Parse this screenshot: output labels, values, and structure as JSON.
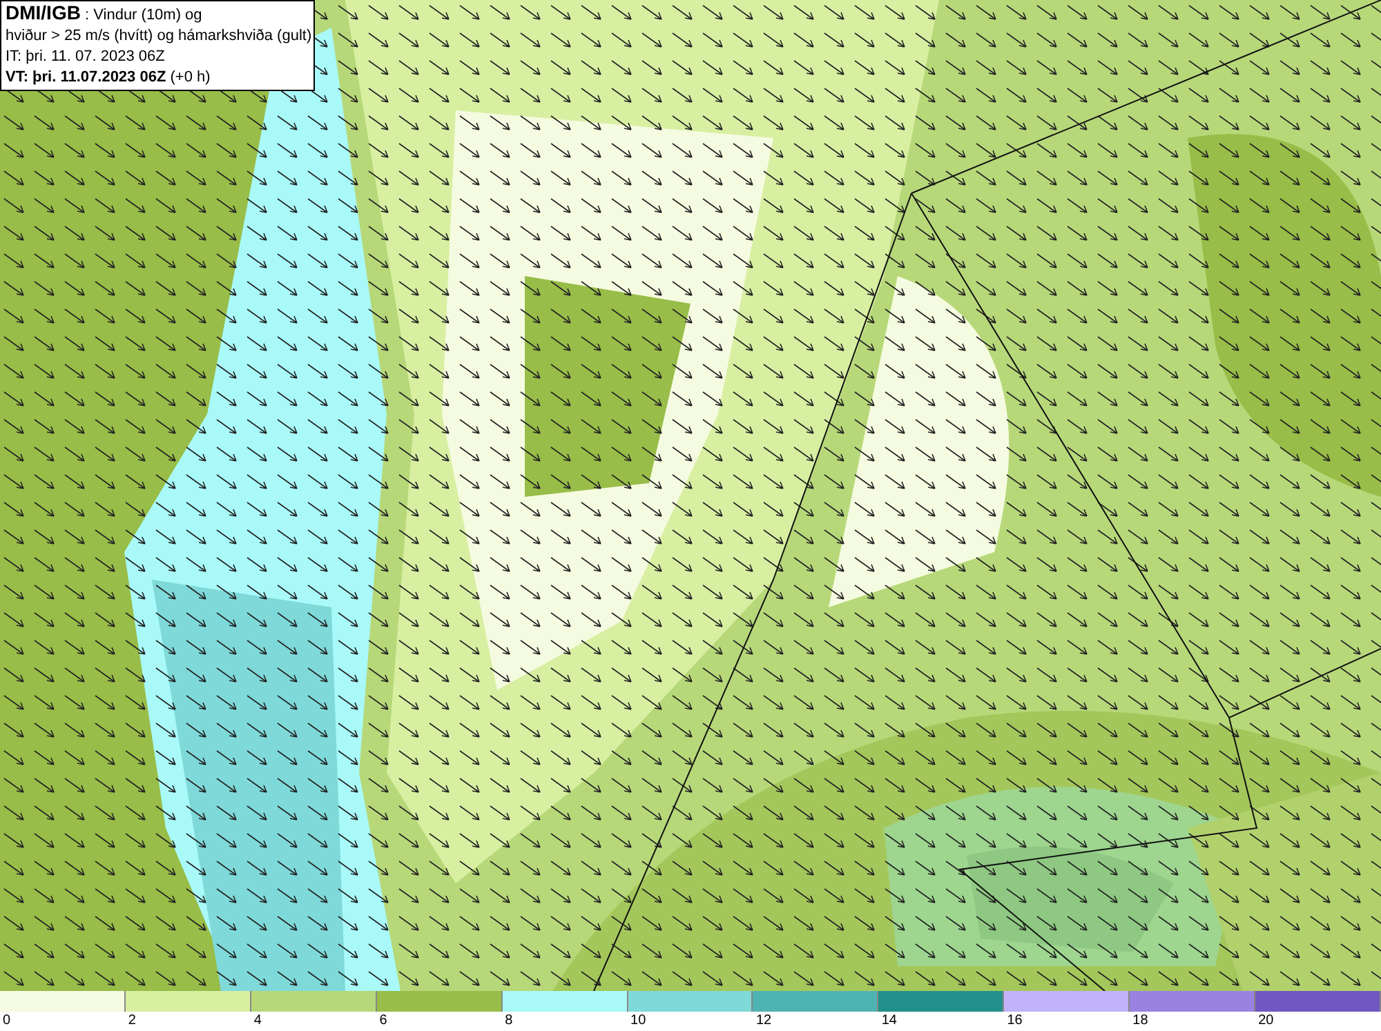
{
  "header": {
    "lines": [
      "**DMI/IGB** : Vindur (10m) og",
      "hviður > 25 m/s (hvítt) og hámarkshviða (gult)",
      "IT: þri. 11. 07. 2023 06Z",
      "**VT: þri. 11.07.2023 06Z** (+0 h)"
    ]
  },
  "legend": {
    "bins": [
      {
        "label": "0",
        "color": "#f5fbe0"
      },
      {
        "label": "2",
        "color": "#d8efa2"
      },
      {
        "label": "4",
        "color": "#b7d879"
      },
      {
        "label": "6",
        "color": "#98bd48"
      },
      {
        "label": "8",
        "color": "#a9f9f9"
      },
      {
        "label": "10",
        "color": "#7fd9d9"
      },
      {
        "label": "12",
        "color": "#4fb3b3"
      },
      {
        "label": "14",
        "color": "#21908c"
      },
      {
        "label": "16",
        "color": "#c1b2f9"
      },
      {
        "label": "18",
        "color": "#9a82e1"
      },
      {
        "label": "20",
        "color": "#7057c1"
      }
    ]
  }
}
